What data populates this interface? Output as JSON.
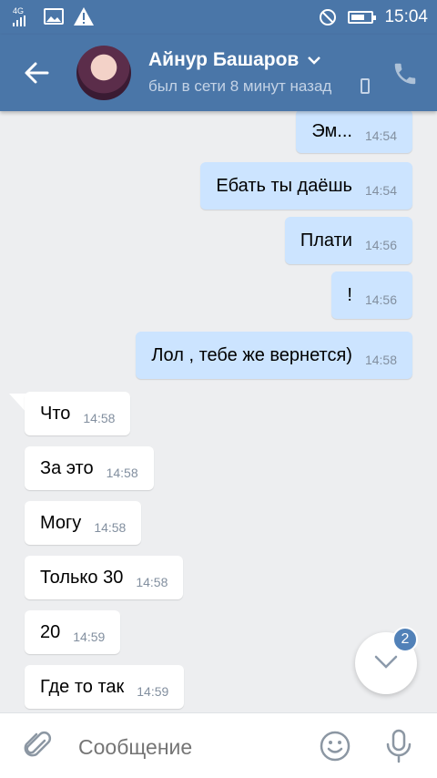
{
  "statusbar": {
    "network": "4G",
    "time": "15:04"
  },
  "header": {
    "name": "Айнур Башаров",
    "status": "был в сети 8 минут назад"
  },
  "messages": [
    {
      "dir": "out",
      "text": "Эм...",
      "time": "14:54"
    },
    {
      "dir": "out",
      "text": "Ебать ты даёшь",
      "time": "14:54"
    },
    {
      "dir": "out",
      "text": "Плати",
      "time": "14:56"
    },
    {
      "dir": "out",
      "text": "!",
      "time": "14:56"
    },
    {
      "dir": "out",
      "text": "Лол , тебе же вернется)",
      "time": "14:58"
    },
    {
      "dir": "in",
      "text": "Что",
      "time": "14:58"
    },
    {
      "dir": "in",
      "text": "За это",
      "time": "14:58"
    },
    {
      "dir": "in",
      "text": "Могу",
      "time": "14:58"
    },
    {
      "dir": "in",
      "text": "Только 30",
      "time": "14:58"
    },
    {
      "dir": "in",
      "text": "20",
      "time": "14:59"
    },
    {
      "dir": "in",
      "text": "Где то так",
      "time": "14:59"
    }
  ],
  "scroll_badge": "2",
  "input": {
    "placeholder": "Сообщение"
  },
  "colors": {
    "accent": "#4a76a8",
    "outgoing": "#cce4ff",
    "incoming": "#ffffff",
    "background": "#edeef0"
  }
}
